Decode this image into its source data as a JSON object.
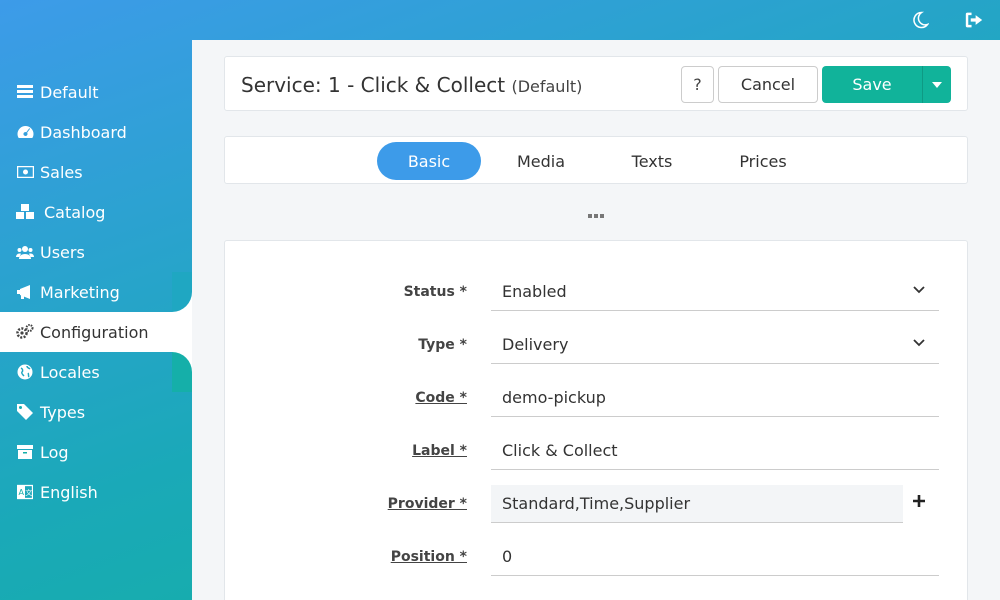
{
  "topbar": {
    "theme_icon": "moon-icon",
    "logout_icon": "sign-out-icon"
  },
  "sidebar": {
    "items": [
      {
        "label": "Default",
        "icon": "server-icon"
      },
      {
        "label": "Dashboard",
        "icon": "tachometer-icon"
      },
      {
        "label": "Sales",
        "icon": "money-bill-icon"
      },
      {
        "label": "Catalog",
        "icon": "cubes-icon"
      },
      {
        "label": "Users",
        "icon": "users-icon"
      },
      {
        "label": "Marketing",
        "icon": "bullhorn-icon"
      },
      {
        "label": "Configuration",
        "icon": "cogs-icon",
        "active": true
      },
      {
        "label": "Locales",
        "icon": "globe-icon"
      },
      {
        "label": "Types",
        "icon": "tag-icon"
      },
      {
        "label": "Log",
        "icon": "archive-icon"
      },
      {
        "label": "English",
        "icon": "language-icon"
      }
    ]
  },
  "header": {
    "title": "Service: 1 - Click & Collect",
    "subtitle": "(Default)",
    "help_label": "?",
    "cancel_label": "Cancel",
    "save_label": "Save"
  },
  "tabs": [
    {
      "label": "Basic",
      "active": true
    },
    {
      "label": "Media"
    },
    {
      "label": "Texts"
    },
    {
      "label": "Prices"
    }
  ],
  "form": {
    "status": {
      "label": "Status *",
      "value": "Enabled"
    },
    "type": {
      "label": "Type *",
      "value": "Delivery"
    },
    "code": {
      "label": "Code *",
      "value": "demo-pickup"
    },
    "label": {
      "label": "Label *",
      "value": "Click & Collect"
    },
    "provider": {
      "label": "Provider *",
      "value": "Standard,Time,Supplier"
    },
    "position": {
      "label": "Position *",
      "value": "0"
    }
  },
  "colors": {
    "accent_blue": "#3d9be9",
    "accent_green": "#11b39a"
  }
}
